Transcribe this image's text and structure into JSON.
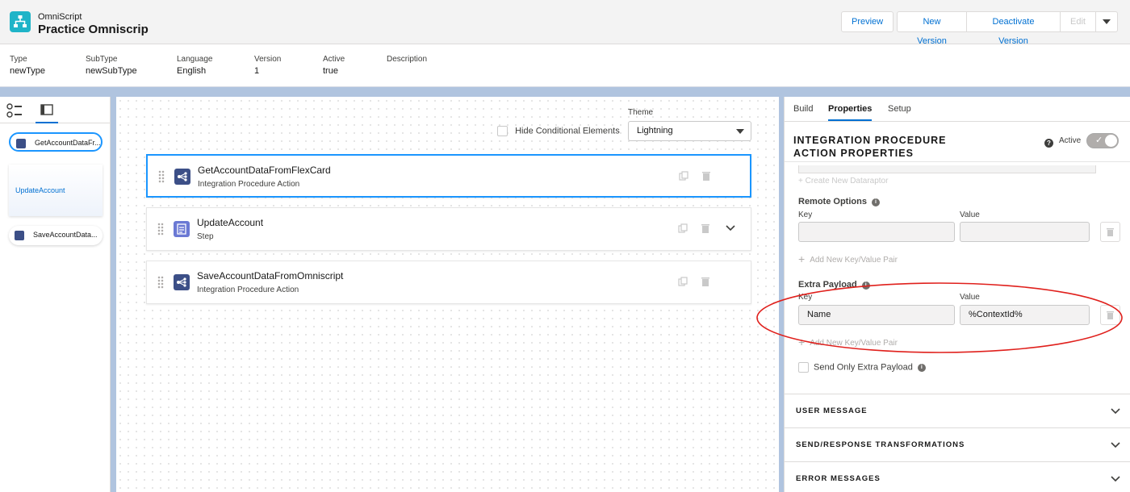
{
  "header": {
    "app_type": "OmniScript",
    "app_name": "Practice Omniscrip",
    "buttons": {
      "preview": "Preview",
      "new_version": "New Version",
      "deactivate_version": "Deactivate Version",
      "edit": "Edit"
    },
    "meta": [
      {
        "label": "Type",
        "value": "newType"
      },
      {
        "label": "SubType",
        "value": "newSubType"
      },
      {
        "label": "Language",
        "value": "English"
      },
      {
        "label": "Version",
        "value": "1"
      },
      {
        "label": "Active",
        "value": "true"
      },
      {
        "label": "Description",
        "value": ""
      }
    ]
  },
  "palette": {
    "items": [
      {
        "label": "GetAccountDataFr...",
        "icon": "integration-procedure-icon",
        "selected": true
      },
      {
        "label": "UpdateAccount",
        "icon": "step",
        "selected": false
      },
      {
        "label": "SaveAccountData...",
        "icon": "integration-procedure-icon",
        "selected": false
      }
    ]
  },
  "canvas": {
    "hide_conditional_label": "Hide Conditional Elements",
    "theme_label": "Theme",
    "theme_value": "Lightning",
    "cards": [
      {
        "title": "GetAccountDataFromFlexCard",
        "subtitle": "Integration Procedure Action",
        "icon": "integration-procedure-icon",
        "selected": true,
        "expandable": false
      },
      {
        "title": "UpdateAccount",
        "subtitle": "Step",
        "icon": "step-list-icon",
        "selected": false,
        "expandable": true
      },
      {
        "title": "SaveAccountDataFromOmniscript",
        "subtitle": "Integration Procedure Action",
        "icon": "integration-procedure-icon",
        "selected": false,
        "expandable": false
      }
    ]
  },
  "properties": {
    "tabs": [
      "Build",
      "Properties",
      "Setup"
    ],
    "active_tab": "Properties",
    "title_line1": "INTEGRATION PROCEDURE",
    "title_line2": "ACTION PROPERTIES",
    "active_label": "Active",
    "active_on": true,
    "create_dataraptor": "+ Create New Dataraptor",
    "remote_options": {
      "label": "Remote Options",
      "key_label": "Key",
      "value_label": "Value",
      "key": "",
      "value": "",
      "add_label": "Add New Key/Value Pair"
    },
    "extra_payload": {
      "label": "Extra Payload",
      "key_label": "Key",
      "value_label": "Value",
      "key": "Name",
      "value": "%ContextId%",
      "add_label": "Add New Key/Value Pair"
    },
    "send_only_label": "Send Only Extra Payload",
    "accordions": [
      "USER MESSAGE",
      "SEND/RESPONSE TRANSFORMATIONS",
      "ERROR MESSAGES"
    ]
  },
  "colors": {
    "brand_blue": "#0070d2",
    "selected_border": "#1b96ff",
    "annotation_red": "#e0201c",
    "app_icon": "#1fb4c8"
  }
}
